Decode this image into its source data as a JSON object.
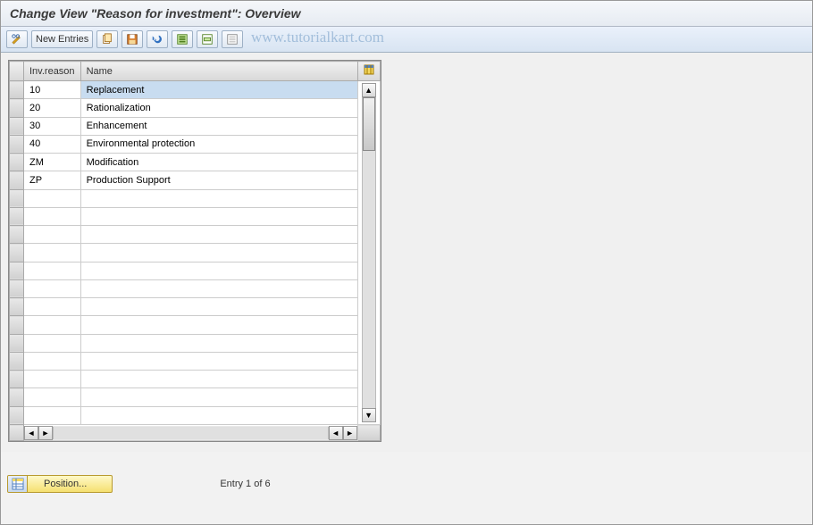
{
  "title": "Change View \"Reason for investment\": Overview",
  "toolbar": {
    "new_entries_label": "New Entries"
  },
  "watermark": "www.tutorialkart.com",
  "table": {
    "headers": {
      "reason": "Inv.reason",
      "name": "Name"
    },
    "rows": [
      {
        "reason": "10",
        "name": "Replacement",
        "selected": true
      },
      {
        "reason": "20",
        "name": "Rationalization"
      },
      {
        "reason": "30",
        "name": "Enhancement"
      },
      {
        "reason": "40",
        "name": "Environmental protection"
      },
      {
        "reason": "ZM",
        "name": "Modification"
      },
      {
        "reason": "ZP",
        "name": "Production Support"
      },
      {
        "reason": "",
        "name": ""
      },
      {
        "reason": "",
        "name": ""
      },
      {
        "reason": "",
        "name": ""
      },
      {
        "reason": "",
        "name": ""
      },
      {
        "reason": "",
        "name": ""
      },
      {
        "reason": "",
        "name": ""
      },
      {
        "reason": "",
        "name": ""
      },
      {
        "reason": "",
        "name": ""
      },
      {
        "reason": "",
        "name": ""
      },
      {
        "reason": "",
        "name": ""
      },
      {
        "reason": "",
        "name": ""
      },
      {
        "reason": "",
        "name": ""
      },
      {
        "reason": "",
        "name": ""
      }
    ]
  },
  "footer": {
    "position_label": "Position...",
    "entry_text": "Entry 1 of 6"
  }
}
